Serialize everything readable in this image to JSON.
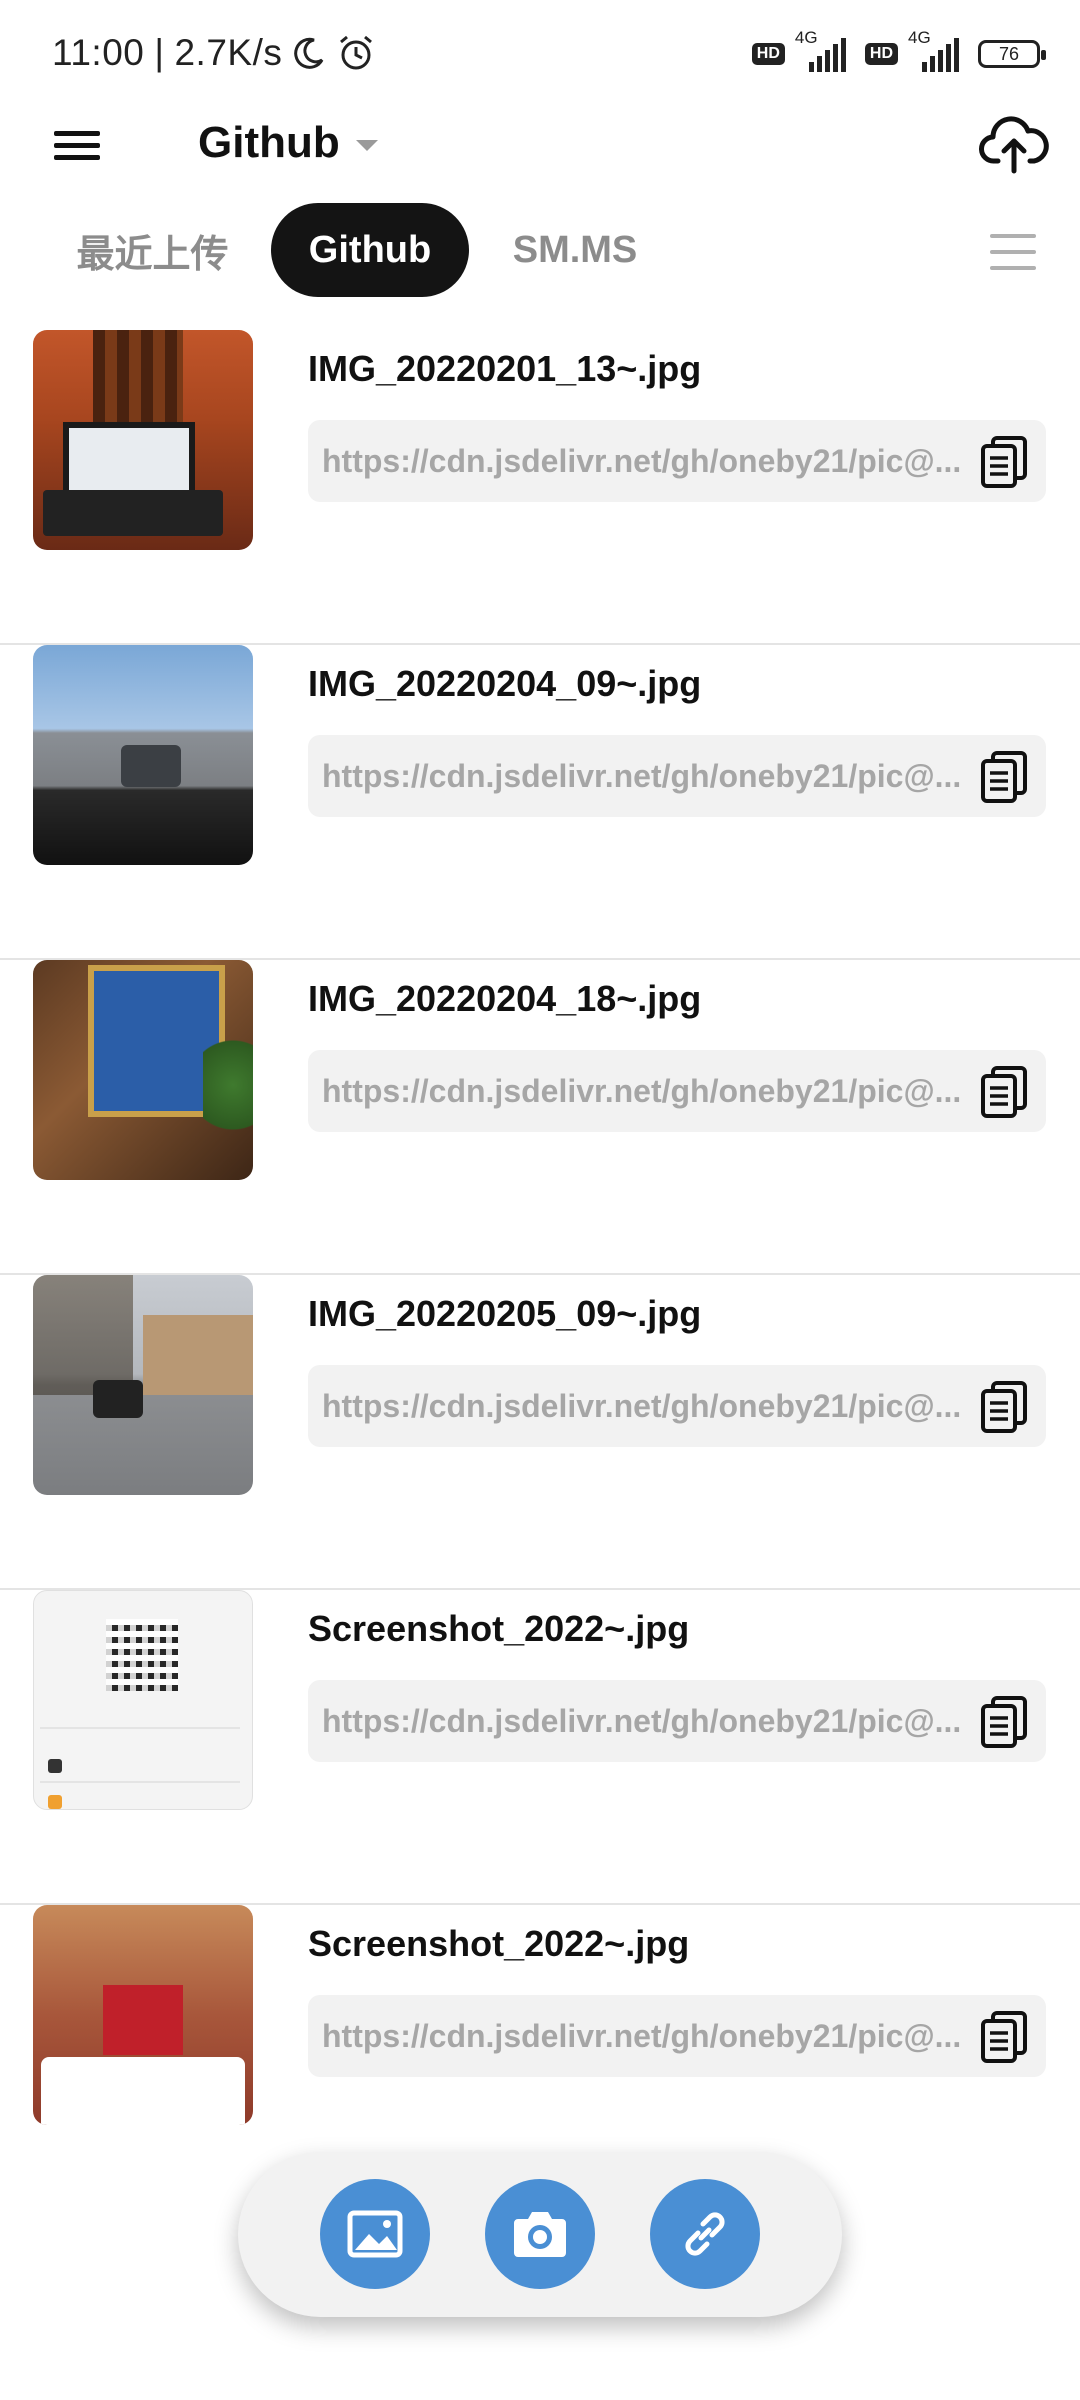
{
  "status_bar": {
    "time": "11:00",
    "separator": "|",
    "speed": "2.7K/s",
    "hd1": "HD",
    "net1": "4G",
    "hd2": "HD",
    "net2": "4G",
    "battery": "76"
  },
  "app_bar": {
    "title": "Github",
    "menu_icon": "hamburger-menu-icon",
    "upload_icon": "cloud-upload-icon"
  },
  "tabs": [
    {
      "label": "最近上传",
      "active": false
    },
    {
      "label": "Github",
      "active": true
    },
    {
      "label": "SM.MS",
      "active": false
    }
  ],
  "images": [
    {
      "filename": "IMG_20220201_13~.jpg",
      "url": "https://cdn.jsdelivr.net/gh/oneby21/pic@..."
    },
    {
      "filename": "IMG_20220204_09~.jpg",
      "url": "https://cdn.jsdelivr.net/gh/oneby21/pic@..."
    },
    {
      "filename": "IMG_20220204_18~.jpg",
      "url": "https://cdn.jsdelivr.net/gh/oneby21/pic@..."
    },
    {
      "filename": "IMG_20220205_09~.jpg",
      "url": "https://cdn.jsdelivr.net/gh/oneby21/pic@..."
    },
    {
      "filename": "Screenshot_2022~.jpg",
      "url": "https://cdn.jsdelivr.net/gh/oneby21/pic@..."
    },
    {
      "filename": "Screenshot_2022~.jpg",
      "url": "https://cdn.jsdelivr.net/gh/oneby21/pic@..."
    }
  ],
  "fab": {
    "gallery_icon": "image-icon",
    "camera_icon": "camera-icon",
    "link_icon": "link-icon"
  },
  "colors": {
    "accent": "#4a8fd4",
    "active_tab": "#141414"
  }
}
